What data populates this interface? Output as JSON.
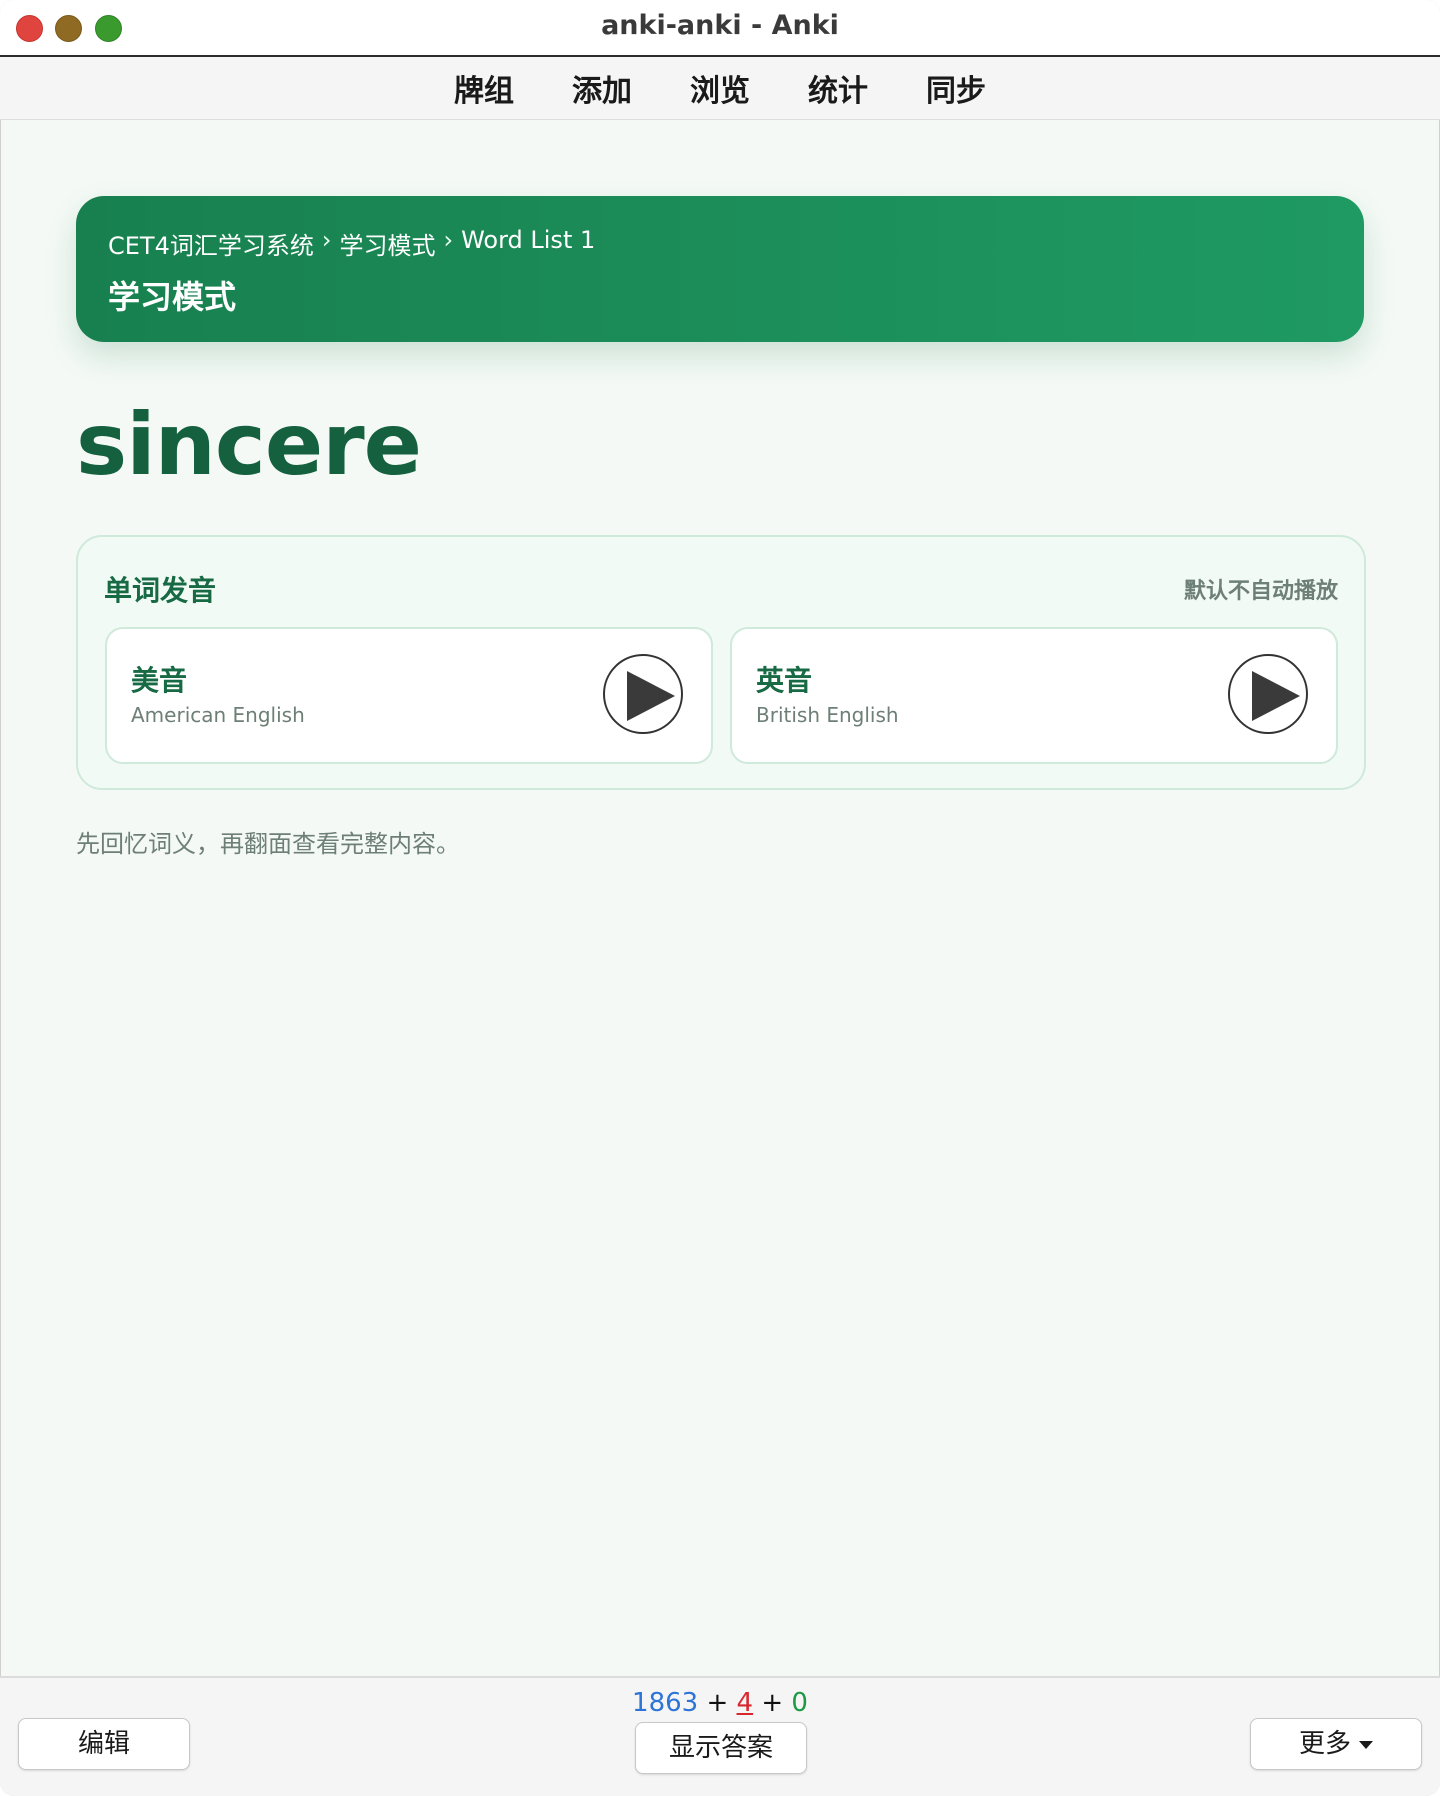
{
  "window": {
    "title": "anki-anki - Anki"
  },
  "topmenu": {
    "items": [
      "牌组",
      "添加",
      "浏览",
      "统计",
      "同步"
    ]
  },
  "header": {
    "breadcrumb": [
      "CET4词汇学习系统",
      "学习模式",
      "Word List 1"
    ],
    "breadcrumb_separator": "›",
    "title": "学习模式"
  },
  "card": {
    "word": "sincere",
    "pronunciation": {
      "title": "单词发音",
      "hint": "默认不自动播放",
      "us": {
        "label": "美音",
        "sub": "American English",
        "icon": "play-icon"
      },
      "uk": {
        "label": "英音",
        "sub": "British English",
        "icon": "play-icon"
      }
    },
    "study_hint": "先回忆词义，再翻面查看完整内容。"
  },
  "bottombar": {
    "edit_label": "编辑",
    "show_answer_label": "显示答案",
    "more_label": "更多",
    "counts": {
      "new": "1863",
      "learn": "4",
      "review": "0",
      "plus": "+"
    }
  },
  "colors": {
    "accent": "#1f9a62",
    "word": "#14603f",
    "new_count": "#2e74d6",
    "learn_count": "#d9272f",
    "review_count": "#1c9a42"
  }
}
